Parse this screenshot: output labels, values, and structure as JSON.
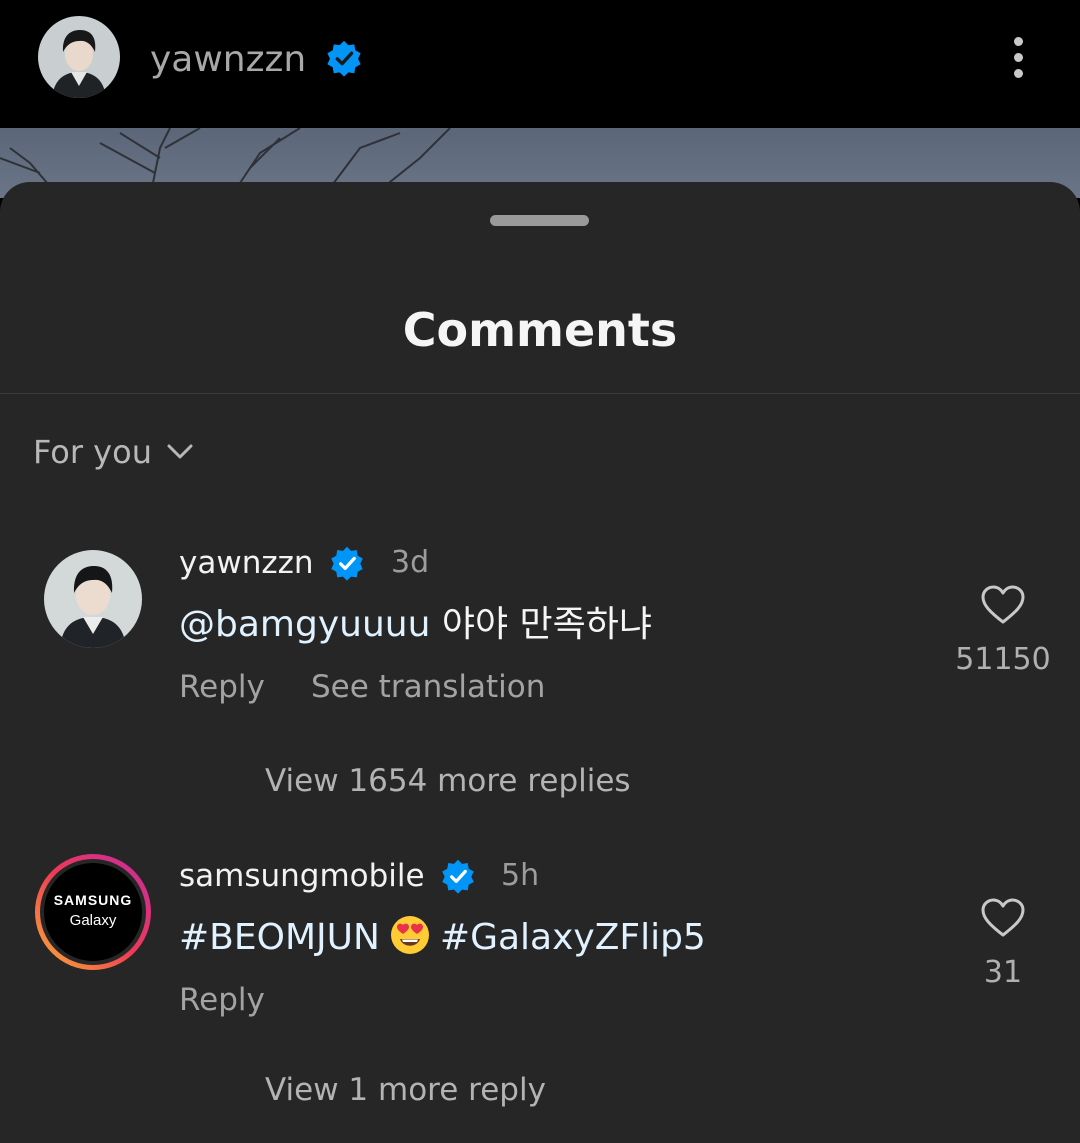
{
  "header": {
    "username": "yawnzzn",
    "verified_color": "#0095f6"
  },
  "sheet": {
    "title": "Comments",
    "sort_label": "For you"
  },
  "comments": [
    {
      "username": "yawnzzn",
      "time": "3d",
      "mention": "@bamgyuuuu",
      "text": "야야 만족하냐",
      "actions": {
        "reply": "Reply",
        "translate": "See translation"
      },
      "likes": "51150",
      "view_replies": "View 1654 more replies"
    },
    {
      "username": "samsungmobile",
      "time": "5h",
      "avatar_text": {
        "line1": "SAMSUNG",
        "line2": "Galaxy"
      },
      "hashtag1": "#BEOMJUN",
      "emoji": "smiling-face-with-heart-eyes",
      "hashtag2": "#GalaxyZFlip5",
      "actions": {
        "reply": "Reply"
      },
      "likes": "31",
      "view_replies": "View 1 more reply"
    }
  ]
}
